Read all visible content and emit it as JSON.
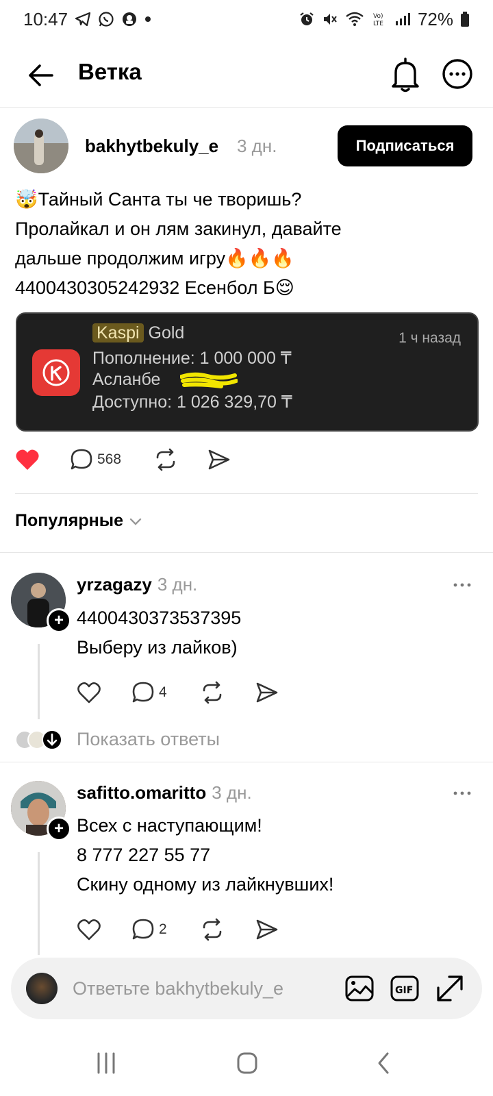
{
  "status_bar": {
    "time": "10:47",
    "battery": "72%",
    "icons": [
      "telegram-icon",
      "whatsapp-icon",
      "app-icon",
      "dot-icon",
      "alarm-icon",
      "mute-icon",
      "wifi-icon",
      "volte-icon",
      "signal-icon",
      "battery-icon"
    ]
  },
  "header": {
    "title": "Ветка",
    "icons": [
      "back-arrow-icon",
      "bell-icon",
      "more-circle-icon"
    ]
  },
  "post": {
    "author": "bakhytbekuly_e",
    "time": "3 дн.",
    "subscribe_label": "Подписаться",
    "lines": [
      "🤯Тайный Санта ты че творишь?",
      "Пролайкал и он лям закинул, давайте",
      "дальше продолжим игру🔥🔥🔥",
      "4400430305242932 Есенбол Б😌"
    ],
    "notification": {
      "app_highlight": "Kaspi",
      "app_rest": " Gold",
      "time": "1 ч назад",
      "line1": "Пополнение: 1 000 000 ₸",
      "line2": "Асланбе",
      "line3": "Доступно: 1 026 329,70 ₸"
    },
    "comments_count": "568",
    "liked": true
  },
  "section": {
    "title": "Популярные"
  },
  "comments": [
    {
      "author": "yrzagazy",
      "time": "3 дн.",
      "lines": [
        "4400430373537395",
        "Выберу из лайков)"
      ],
      "comments_count": "4",
      "show_replies": "Показать ответы"
    },
    {
      "author": "safitto.omaritto",
      "time": "3 дн.",
      "lines": [
        "Всех с наступающим!",
        "8 777 227 55 77",
        "Скину одному из лайкнувших!"
      ],
      "comments_count": "2"
    }
  ],
  "reply_bar": {
    "placeholder": "Ответьте bakhytbekuly_e",
    "icons": [
      "image-icon",
      "gif-icon",
      "expand-icon"
    ]
  },
  "nav": {
    "icons": [
      "recent-apps-icon",
      "home-icon",
      "back-icon"
    ]
  },
  "colors": {
    "like_red": "#ff3040",
    "card_bg": "#1f1f1f",
    "kaspi_red": "#e53935",
    "muted_text": "#999999"
  }
}
